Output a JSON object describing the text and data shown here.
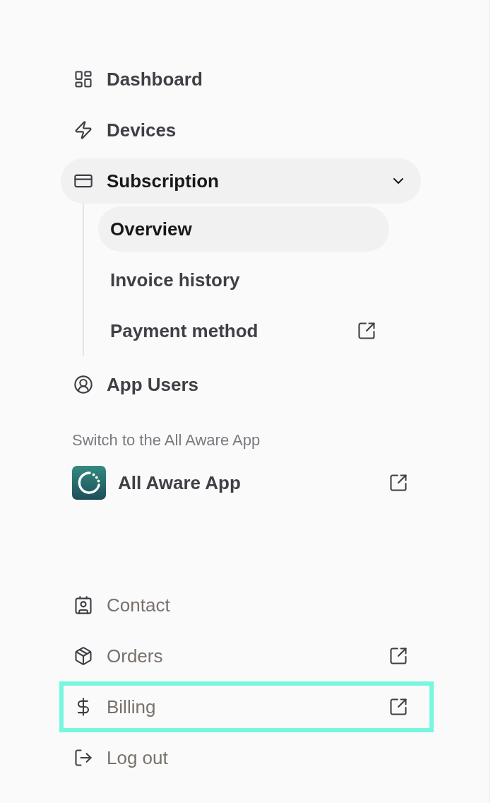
{
  "nav": [
    {
      "kind": "dashboard",
      "label": "Dashboard",
      "expanded": false
    },
    {
      "kind": "devices",
      "label": "Devices",
      "expanded": false
    },
    {
      "kind": "subscription",
      "label": "Subscription",
      "expanded": true,
      "children": [
        {
          "label": "Overview",
          "selected": true,
          "external": false
        },
        {
          "label": "Invoice history",
          "selected": false,
          "external": false
        },
        {
          "label": "Payment method",
          "selected": false,
          "external": true
        }
      ]
    },
    {
      "kind": "users",
      "label": "App Users",
      "expanded": false
    }
  ],
  "switch_section": {
    "heading": "Switch to the All Aware App",
    "app": {
      "label": "All Aware App",
      "external": true
    }
  },
  "footer": [
    {
      "kind": "contact",
      "label": "Contact",
      "external": false,
      "highlighted": false
    },
    {
      "kind": "orders",
      "label": "Orders",
      "external": true,
      "highlighted": false
    },
    {
      "kind": "billing",
      "label": "Billing",
      "external": true,
      "highlighted": true
    },
    {
      "kind": "logout",
      "label": "Log out",
      "external": false,
      "highlighted": false
    }
  ]
}
